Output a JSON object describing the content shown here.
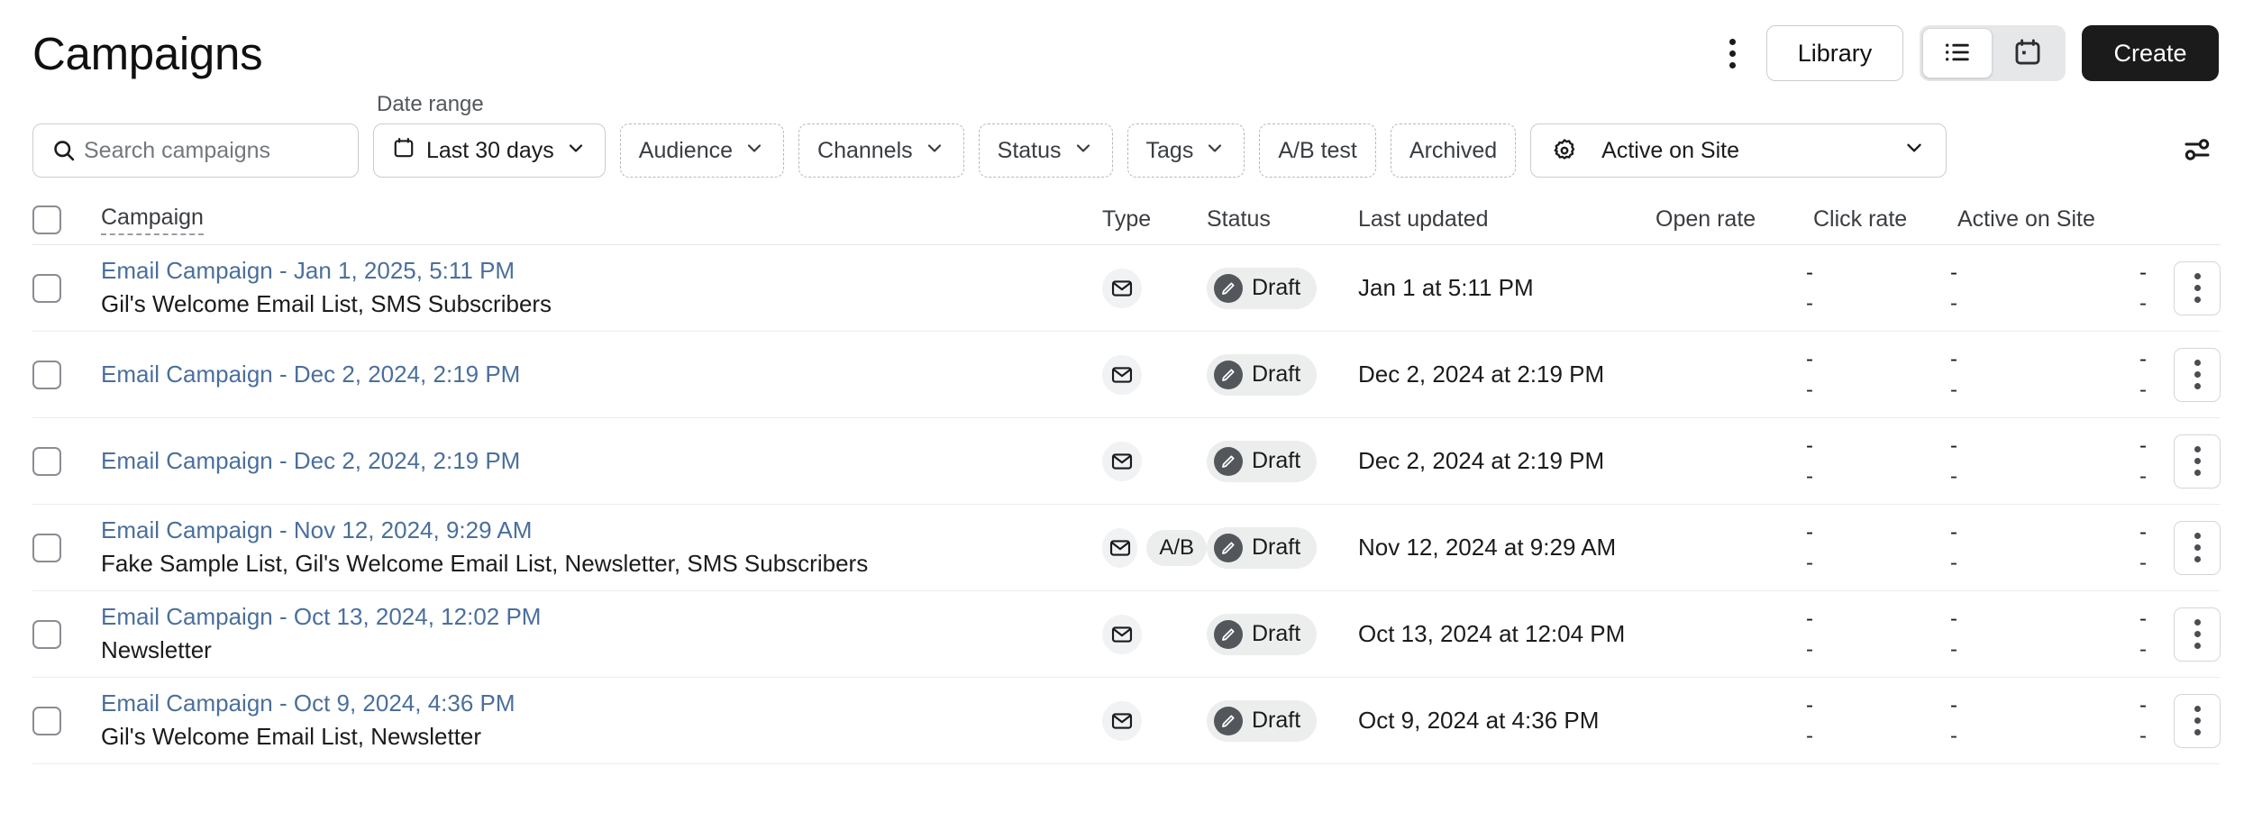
{
  "header": {
    "title": "Campaigns",
    "kebab_icon": "kebab-vertical-icon",
    "library_label": "Library",
    "view_toggle": {
      "list_icon": "list-view-icon",
      "calendar_icon": "calendar-view-icon",
      "active": "list"
    },
    "create_label": "Create"
  },
  "filters": {
    "search": {
      "placeholder": "Search campaigns",
      "value": "",
      "icon": "search-icon"
    },
    "date_range_label": "Date range",
    "date_range_value": "Last 30 days",
    "date_range_icon": "calendar-icon",
    "audience_label": "Audience",
    "channels_label": "Channels",
    "status_label": "Status",
    "tags_label": "Tags",
    "ab_test_label": "A/B test",
    "archived_label": "Archived",
    "active_on_site_label": "Active on Site",
    "active_on_site_icon": "gear-icon",
    "chevron_icon": "chevron-down-icon",
    "settings_icon": "sliders-icon"
  },
  "table": {
    "columns": {
      "campaign": "Campaign",
      "type": "Type",
      "status": "Status",
      "last_updated": "Last updated",
      "open_rate": "Open rate",
      "click_rate": "Click rate",
      "active_on_site": "Active on Site"
    },
    "empty_value": "-",
    "rows": [
      {
        "name": "Email Campaign - Jan 1, 2025, 5:11 PM",
        "subtitle": "Gil's Welcome Email List, SMS Subscribers",
        "type_icon": "email-icon",
        "ab": "",
        "status": "Draft",
        "status_icon": "pencil-icon",
        "last_updated": "Jan 1 at 5:11 PM",
        "open_rate": "-",
        "open_rate_sub": "-",
        "click_rate": "-",
        "click_rate_sub": "-",
        "active_on_site": "-",
        "active_on_site_sub": "-"
      },
      {
        "name": "Email Campaign - Dec 2, 2024, 2:19 PM",
        "subtitle": "",
        "type_icon": "email-icon",
        "ab": "",
        "status": "Draft",
        "status_icon": "pencil-icon",
        "last_updated": "Dec 2, 2024 at 2:19 PM",
        "open_rate": "-",
        "open_rate_sub": "-",
        "click_rate": "-",
        "click_rate_sub": "-",
        "active_on_site": "-",
        "active_on_site_sub": "-"
      },
      {
        "name": "Email Campaign - Dec 2, 2024, 2:19 PM",
        "subtitle": "",
        "type_icon": "email-icon",
        "ab": "",
        "status": "Draft",
        "status_icon": "pencil-icon",
        "last_updated": "Dec 2, 2024 at 2:19 PM",
        "open_rate": "-",
        "open_rate_sub": "-",
        "click_rate": "-",
        "click_rate_sub": "-",
        "active_on_site": "-",
        "active_on_site_sub": "-"
      },
      {
        "name": "Email Campaign - Nov 12, 2024, 9:29 AM",
        "subtitle": "Fake Sample List, Gil's Welcome Email List, Newsletter, SMS Subscribers",
        "type_icon": "email-icon",
        "ab": "A/B",
        "status": "Draft",
        "status_icon": "pencil-icon",
        "last_updated": "Nov 12, 2024 at 9:29 AM",
        "open_rate": "-",
        "open_rate_sub": "-",
        "click_rate": "-",
        "click_rate_sub": "-",
        "active_on_site": "-",
        "active_on_site_sub": "-"
      },
      {
        "name": "Email Campaign - Oct 13, 2024, 12:02 PM",
        "subtitle": "Newsletter",
        "type_icon": "email-icon",
        "ab": "",
        "status": "Draft",
        "status_icon": "pencil-icon",
        "last_updated": "Oct 13, 2024 at 12:04 PM",
        "open_rate": "-",
        "open_rate_sub": "-",
        "click_rate": "-",
        "click_rate_sub": "-",
        "active_on_site": "-",
        "active_on_site_sub": "-"
      },
      {
        "name": "Email Campaign - Oct 9, 2024, 4:36 PM",
        "subtitle": "Gil's Welcome Email List, Newsletter",
        "type_icon": "email-icon",
        "ab": "",
        "status": "Draft",
        "status_icon": "pencil-icon",
        "last_updated": "Oct 9, 2024 at 4:36 PM",
        "open_rate": "-",
        "open_rate_sub": "-",
        "click_rate": "-",
        "click_rate_sub": "-",
        "active_on_site": "-",
        "active_on_site_sub": "-"
      }
    ]
  },
  "colors": {
    "link": "#4a6f9c",
    "create_bg": "#1b1b1b",
    "badge_bg": "#eceded",
    "border": "#c9ccd0"
  }
}
